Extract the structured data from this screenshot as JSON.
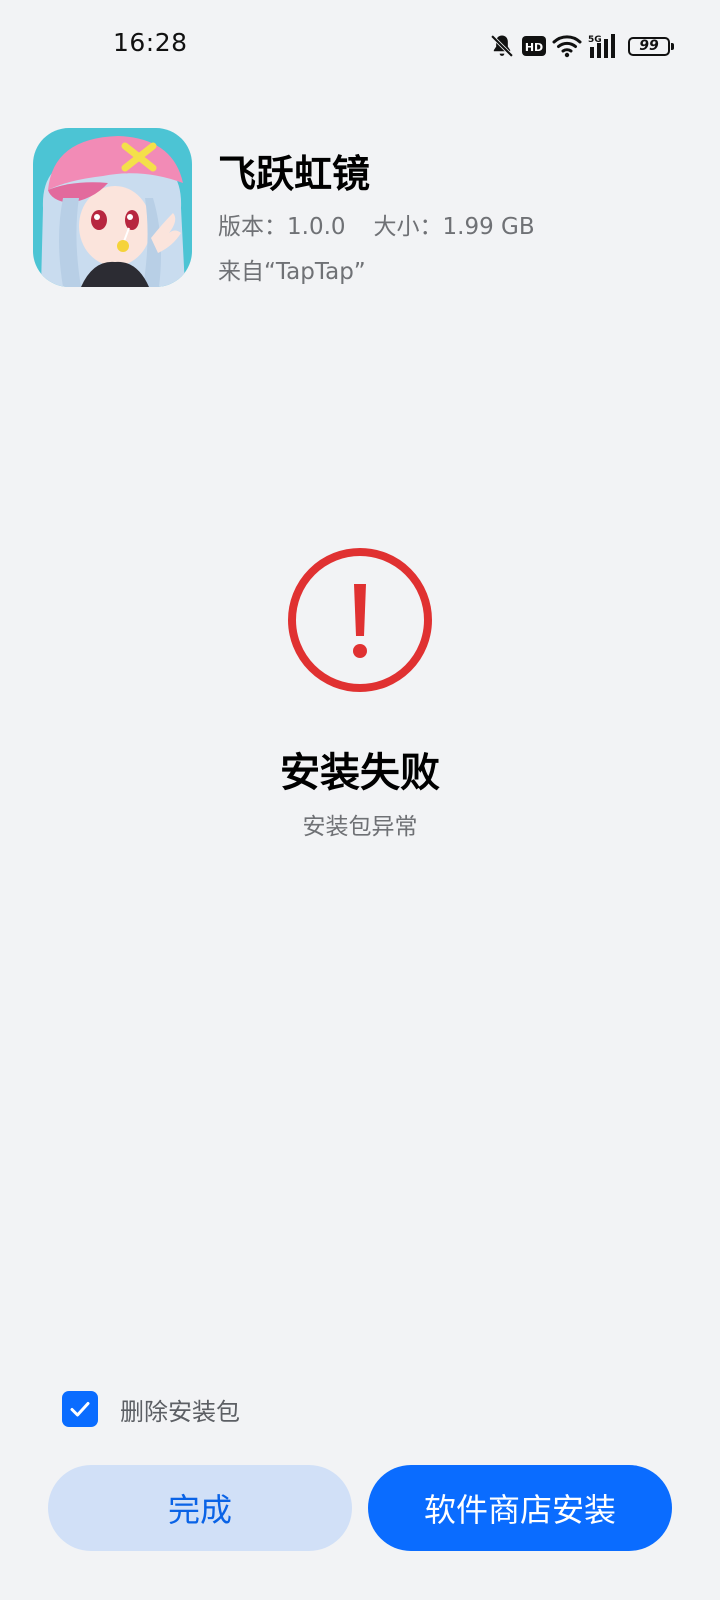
{
  "status_bar": {
    "time": "16:28",
    "icons": [
      "bell-off-icon",
      "hd-icon",
      "wifi-icon",
      "5g-signal-icon",
      "battery-icon"
    ],
    "hd_label": "HD",
    "network_label": "5G",
    "battery_level": "99"
  },
  "app": {
    "name": "飞跃虹镜",
    "version": "版本：1.0.0",
    "size": "大小：1.99 GB",
    "source": "来自“TapTap”"
  },
  "result": {
    "title": "安装失败",
    "subtitle": "安装包异常",
    "icon": "error-exclamation-icon",
    "color": "#e03131"
  },
  "options": {
    "delete_package_label": "删除安装包",
    "delete_package_checked": true
  },
  "buttons": {
    "done_label": "完成",
    "store_install_label": "软件商店安装"
  },
  "colors": {
    "accent": "#0a6cff",
    "accent_light": "#d1e0f7",
    "error": "#e03131",
    "background": "#f2f3f5"
  }
}
